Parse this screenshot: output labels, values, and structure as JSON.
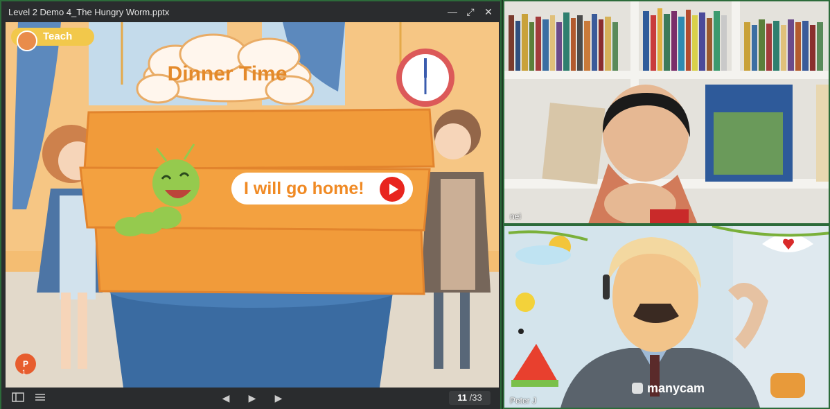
{
  "presentation": {
    "window_title": "Level 2 Demo 4_The Hungry Worm.pptx",
    "controls": {
      "minimize": "—",
      "restore": "⤢",
      "close": "✕"
    },
    "slide": {
      "teach_label": "Teach",
      "title": "Dinner Time",
      "speech": "I will go home!",
      "ppt_badge": "P",
      "ppt_count": "1"
    },
    "footer": {
      "current_page": "11",
      "total_pages": "/33",
      "prev": "◀",
      "play": "▶",
      "next": "▶"
    }
  },
  "videos": [
    {
      "name": "nei"
    },
    {
      "name": "Peter J",
      "watermark": "manycam"
    }
  ],
  "colors": {
    "accent_green": "#2c6b3a",
    "wood": "#f0932a",
    "play_red": "#e8251e"
  }
}
